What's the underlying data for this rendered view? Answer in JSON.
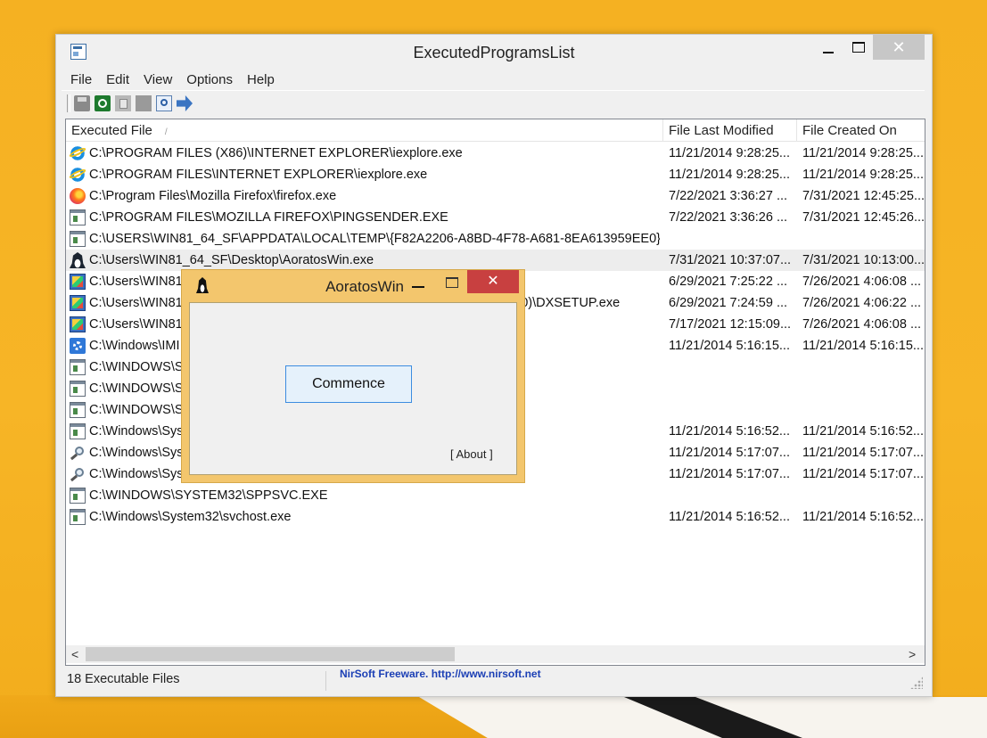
{
  "window": {
    "title": "ExecutedProgramsList",
    "close_glyph": "✕"
  },
  "menu": [
    "File",
    "Edit",
    "View",
    "Options",
    "Help"
  ],
  "toolbar": {
    "icons": [
      "save-icon",
      "refresh-icon",
      "copy-icon",
      "html-report-icon",
      "find-icon",
      "exit-icon"
    ]
  },
  "columns": [
    "Executed File",
    "File Last Modified",
    "File Created On"
  ],
  "sort_indicator": "/",
  "rows": [
    {
      "icon": "ie",
      "file": "C:\\PROGRAM FILES (X86)\\INTERNET EXPLORER\\iexplore.exe",
      "modified": "11/21/2014 9:28:25...",
      "created": "11/21/2014 9:28:25..."
    },
    {
      "icon": "ie",
      "file": "C:\\PROGRAM FILES\\INTERNET EXPLORER\\iexplore.exe",
      "modified": "11/21/2014 9:28:25...",
      "created": "11/21/2014 9:28:25..."
    },
    {
      "icon": "firefox",
      "file": "C:\\Program Files\\Mozilla Firefox\\firefox.exe",
      "modified": "7/22/2021 3:36:27 ...",
      "created": "7/31/2021 12:45:25..."
    },
    {
      "icon": "exe",
      "file": "C:\\PROGRAM FILES\\MOZILLA FIREFOX\\PINGSENDER.EXE",
      "modified": "7/22/2021 3:36:26 ...",
      "created": "7/31/2021 12:45:26..."
    },
    {
      "icon": "exe",
      "file": "C:\\USERS\\WIN81_64_SF\\APPDATA\\LOCAL\\TEMP\\{F82A2206-A8BD-4F78-A681-8EA613959EE0}\\...",
      "modified": "",
      "created": ""
    },
    {
      "icon": "tux",
      "file": "C:\\Users\\WIN81_64_SF\\Desktop\\AoratosWin.exe",
      "modified": "7/31/2021 10:37:07...",
      "created": "7/31/2021 10:13:00..."
    },
    {
      "icon": "setup",
      "file": "C:\\Users\\WIN81",
      "modified": "6/29/2021 7:25:22 ...",
      "created": "7/26/2021 4:06:08 ..."
    },
    {
      "icon": "setup",
      "file": "C:\\Users\\WIN81",
      "file_tail": "2010)\\DXSETUP.exe",
      "modified": "6/29/2021 7:24:59 ...",
      "created": "7/26/2021 4:06:22 ..."
    },
    {
      "icon": "setup",
      "file": "C:\\Users\\WIN81",
      "modified": "7/17/2021 12:15:09...",
      "created": "7/26/2021 4:06:08 ..."
    },
    {
      "icon": "gear",
      "file": "C:\\Windows\\IMI",
      "modified": "11/21/2014 5:16:15...",
      "created": "11/21/2014 5:16:15..."
    },
    {
      "icon": "exe",
      "file": "C:\\WINDOWS\\SY",
      "modified": "",
      "created": ""
    },
    {
      "icon": "exe",
      "file": "C:\\WINDOWS\\SY",
      "modified": "",
      "created": ""
    },
    {
      "icon": "exe",
      "file": "C:\\WINDOWS\\SY",
      "modified": "",
      "created": ""
    },
    {
      "icon": "exe",
      "file": "C:\\Windows\\Sys",
      "modified": "11/21/2014 5:16:52...",
      "created": "11/21/2014 5:16:52..."
    },
    {
      "icon": "search",
      "file": "C:\\Windows\\Sys",
      "modified": "11/21/2014 5:17:07...",
      "created": "11/21/2014 5:17:07..."
    },
    {
      "icon": "search",
      "file": "C:\\Windows\\Sys",
      "modified": "11/21/2014 5:17:07...",
      "created": "11/21/2014 5:17:07..."
    },
    {
      "icon": "exe",
      "file": "C:\\WINDOWS\\SYSTEM32\\SPPSVC.EXE",
      "modified": "",
      "created": ""
    },
    {
      "icon": "exe",
      "file": "C:\\Windows\\System32\\svchost.exe",
      "modified": "11/21/2014 5:16:52...",
      "created": "11/21/2014 5:16:52..."
    }
  ],
  "selected_row": 5,
  "scroll": {
    "left": "<",
    "right": ">"
  },
  "status": {
    "count": "18 Executable Files",
    "link": "NirSoft Freeware.  http://www.nirsoft.net"
  },
  "dialog": {
    "title": "AoratosWin",
    "close_glyph": "✕",
    "button": "Commence",
    "about": "[ About ]"
  }
}
